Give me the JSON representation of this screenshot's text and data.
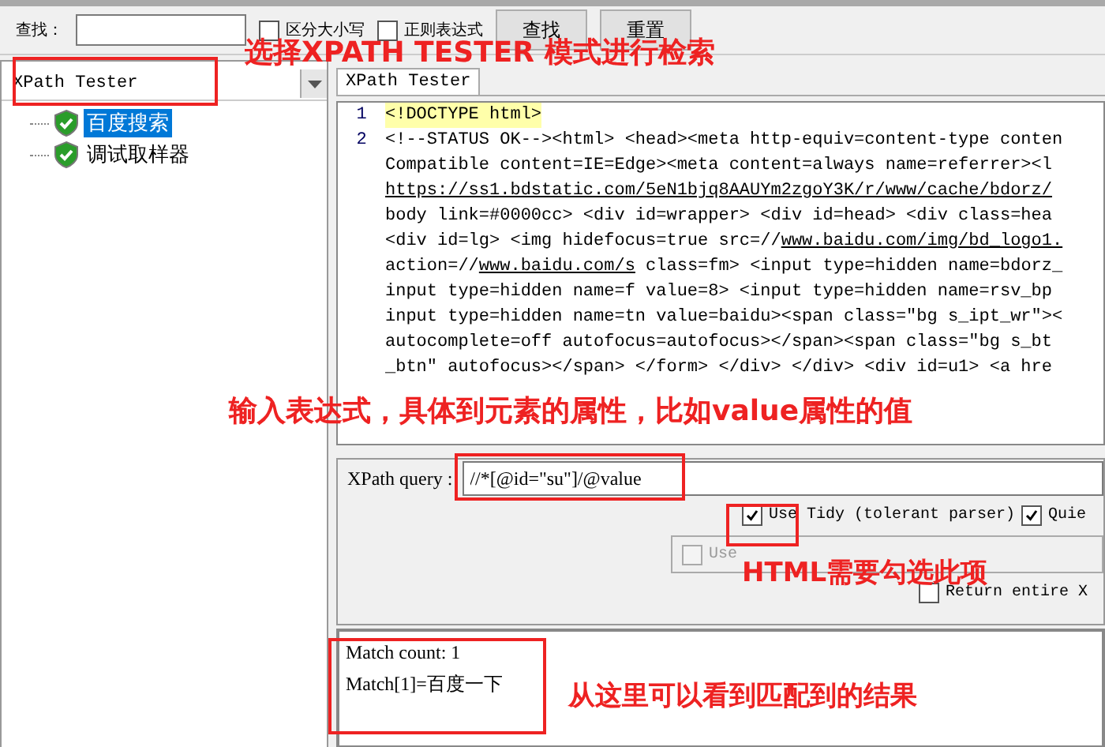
{
  "search_bar": {
    "label": "查找：",
    "options": [
      {
        "label": "区分大小写",
        "checked": false
      },
      {
        "label": "正则表达式",
        "checked": false
      }
    ],
    "buttons": [
      "查找",
      "重置"
    ]
  },
  "left_panel": {
    "mode": "XPath Tester",
    "tree": [
      {
        "label": "百度搜索",
        "selected": true
      },
      {
        "label": "调试取样器",
        "selected": false
      }
    ]
  },
  "tab": {
    "label": "XPath Tester"
  },
  "editor": {
    "lines": [
      {
        "number": "1",
        "highlighted": true,
        "rows": [
          {
            "parts": [
              {
                "text": "<!DOCTYPE html>",
                "link": false
              }
            ]
          }
        ]
      },
      {
        "number": "2",
        "highlighted": false,
        "rows": [
          {
            "parts": [
              {
                "text": "<!--STATUS OK--><html> <head><meta http-equiv=content-type conten",
                "link": false
              }
            ]
          },
          {
            "parts": [
              {
                "text": "Compatible content=IE=Edge><meta content=always name=referrer><l",
                "link": false
              }
            ]
          },
          {
            "parts": [
              {
                "text": "https://ss1.bdstatic.com/5eN1bjq8AAUYm2zgoY3K/r/www/cache/bdorz/",
                "link": true
              }
            ]
          },
          {
            "parts": [
              {
                "text": "body link=#0000cc> <div id=wrapper> <div id=head> <div class=hea",
                "link": false
              }
            ]
          },
          {
            "parts": [
              {
                "text": "<div id=lg> <img hidefocus=true src=//",
                "link": false
              },
              {
                "text": "www.baidu.com/img/bd_logo1.",
                "link": true
              }
            ]
          },
          {
            "parts": [
              {
                "text": "action=//",
                "link": false
              },
              {
                "text": "www.baidu.com/s",
                "link": true
              },
              {
                "text": " class=fm> <input type=hidden name=bdorz_",
                "link": false
              }
            ]
          },
          {
            "parts": [
              {
                "text": "input type=hidden name=f value=8> <input type=hidden name=rsv_bp",
                "link": false
              }
            ]
          },
          {
            "parts": [
              {
                "text": "input type=hidden name=tn value=baidu><span class=\"bg s_ipt_wr\"><",
                "link": false
              }
            ]
          },
          {
            "parts": [
              {
                "text": "autocomplete=off autofocus=autofocus></span><span class=\"bg s_bt",
                "link": false
              }
            ]
          },
          {
            "parts": [
              {
                "text": "_btn\" autofocus></span> </form> </div> </div> <div id=u1> <a hre",
                "link": false
              }
            ]
          }
        ]
      }
    ]
  },
  "query": {
    "label": "XPath query :",
    "value": "//*[@id=\"su\"]/@value",
    "options": [
      {
        "label": "Use Tidy (tolerant parser)",
        "checked": true,
        "disabled": false
      },
      {
        "label": "Quie",
        "checked": true,
        "disabled": false
      }
    ],
    "tidy_options": [
      {
        "label": "Use",
        "checked": false,
        "disabled": true
      }
    ],
    "return_option": {
      "label": "Return entire X",
      "checked": false,
      "disabled": false
    }
  },
  "results": [
    "Match count: 1",
    "Match[1]=百度一下"
  ],
  "annotations": [
    {
      "text": "选择XPATH TESTER 模式进行检索"
    },
    {
      "text": "输入表达式，具体到元素的属性，比如value属性的值"
    },
    {
      "text": "HTML需要勾选此项"
    },
    {
      "text": "从这里可以看到匹配到的结果"
    }
  ]
}
